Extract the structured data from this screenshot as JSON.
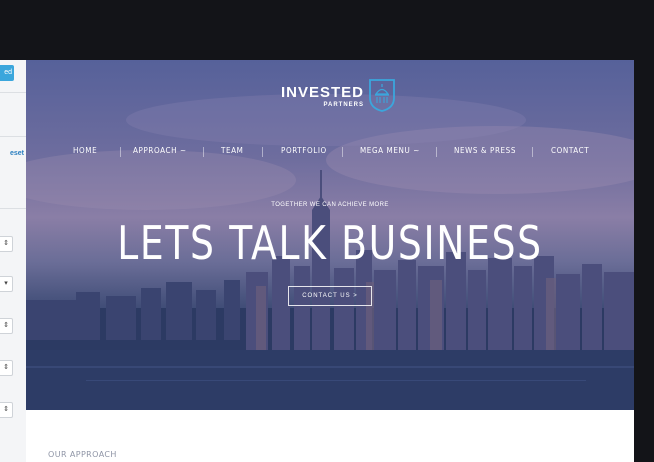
{
  "left_panel": {
    "button_label": "ed",
    "reset_label": "eset",
    "select_arrows": [
      "⇕",
      "▾",
      "⇕",
      "⇕",
      "⇕"
    ]
  },
  "logo": {
    "main": "INVESTED",
    "sub": "PARTNERS"
  },
  "nav": {
    "items": [
      {
        "label": "HOME"
      },
      {
        "label": "APPROACH ~"
      },
      {
        "label": "TEAM"
      },
      {
        "label": "PORTFOLIO"
      },
      {
        "label": "MEGA MENU ~"
      },
      {
        "label": "NEWS & PRESS"
      },
      {
        "label": "CONTACT"
      }
    ]
  },
  "hero": {
    "tagline": "TOGETHER WE CAN ACHIEVE MORE",
    "headline": "LETS TALK BUSINESS",
    "cta_label": "CONTACT US >"
  },
  "section": {
    "title": "OUR APPROACH"
  },
  "colors": {
    "accent": "#3ba6dc",
    "dark": "#131418",
    "cta_arrow": "#d84a3a"
  }
}
